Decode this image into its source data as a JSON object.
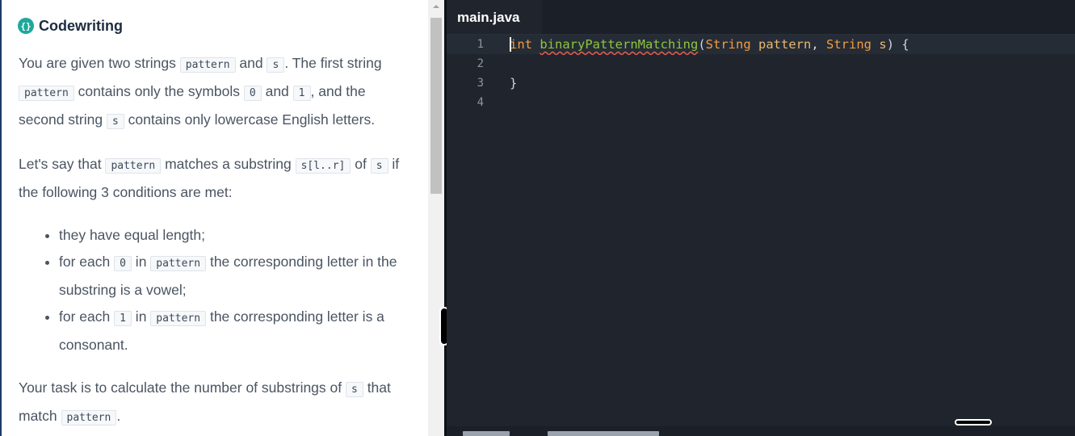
{
  "brand": {
    "name": "Codewriting",
    "logo_glyph": "{}"
  },
  "description": {
    "p1": {
      "t1": "You are given two strings ",
      "c1": "pattern",
      "t2": " and ",
      "c2": "s",
      "t3": ". The first string ",
      "c3": "pattern",
      "t4": " contains only the symbols ",
      "c4": "0",
      "t5": " and ",
      "c5": "1",
      "t6": ", and the second string ",
      "c6": "s",
      "t7": " contains only lowercase English letters."
    },
    "p2": {
      "t1": "Let's say that ",
      "c1": "pattern",
      "t2": " matches a substring ",
      "c2": "s[l..r]",
      "t3": " of ",
      "c3": "s",
      "t4": " if the following 3 conditions are met:"
    },
    "bullets": {
      "b1": "they have equal length;",
      "b2": {
        "t1": "for each ",
        "c1": "0",
        "t2": " in ",
        "c2": "pattern",
        "t3": " the corresponding letter in the substring is a vowel;"
      },
      "b3": {
        "t1": "for each ",
        "c1": "1",
        "t2": " in ",
        "c2": "pattern",
        "t3": " the corresponding letter is a consonant."
      }
    },
    "p3": {
      "t1": "Your task is to calculate the number of substrings of ",
      "c1": "s",
      "t2": " that match ",
      "c2": "pattern",
      "t3": "."
    }
  },
  "editor": {
    "tab_label": "main.java",
    "lines": [
      {
        "num": "1",
        "kw": "int",
        "fn": "binaryPatternMatching",
        "open": "(",
        "type1": "String",
        "arg1": "pattern",
        "comma": ", ",
        "type2": "String",
        "arg2": "s",
        "close": ") {"
      },
      {
        "num": "2",
        "text": ""
      },
      {
        "num": "3",
        "text": "}"
      },
      {
        "num": "4",
        "text": ""
      }
    ]
  },
  "colors": {
    "accent": "#1fa89c",
    "editor_bg": "#1f242d",
    "keyword": "#f39c3d",
    "function": "#8cc63f"
  }
}
